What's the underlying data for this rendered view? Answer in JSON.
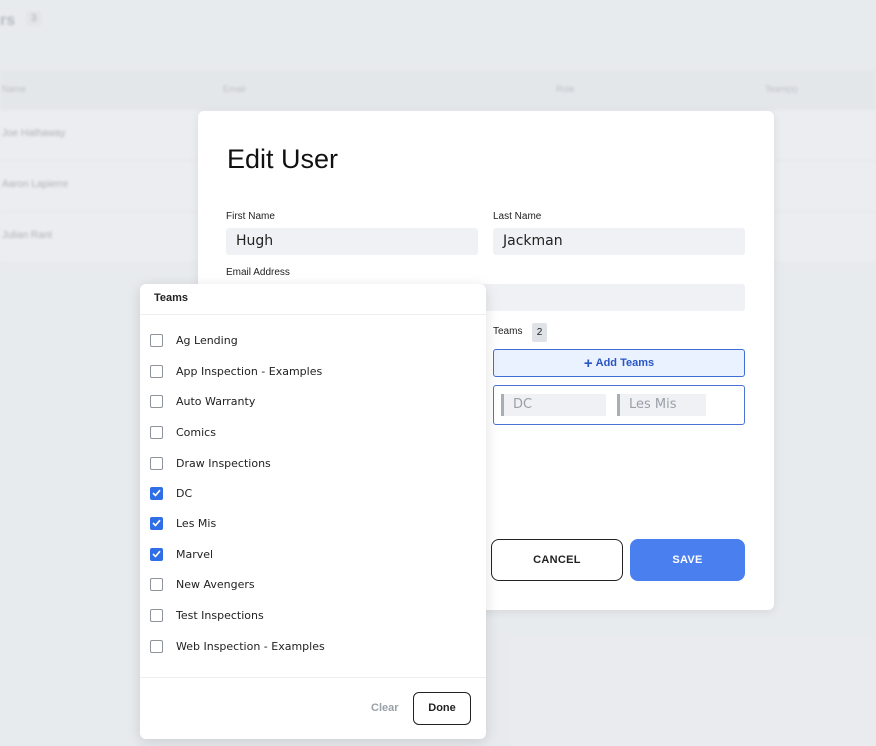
{
  "background": {
    "title_partial": "rs",
    "count": "3",
    "columns": [
      "Name",
      "Email",
      "Role",
      "Team(s)"
    ],
    "rows": [
      "Joe Hathaway",
      "Aaron Lapierre",
      "Julian Rant"
    ]
  },
  "modal": {
    "title": "Edit User",
    "first_name_label": "First Name",
    "first_name_value": "Hugh",
    "last_name_label": "Last Name",
    "last_name_value": "Jackman",
    "email_label": "Email Address",
    "email_value": "",
    "teams_label": "Teams",
    "teams_count": "2",
    "add_teams_label": "Add Teams",
    "chips": [
      "DC",
      "Les Mis"
    ],
    "cancel_label": "CANCEL",
    "save_label": "SAVE"
  },
  "teams_popover": {
    "title": "Teams",
    "options": [
      {
        "label": "Ag Lending",
        "checked": false
      },
      {
        "label": "App Inspection - Examples",
        "checked": false
      },
      {
        "label": "Auto Warranty",
        "checked": false
      },
      {
        "label": "Comics",
        "checked": false
      },
      {
        "label": "Draw Inspections",
        "checked": false
      },
      {
        "label": "DC",
        "checked": true
      },
      {
        "label": "Les Mis",
        "checked": true
      },
      {
        "label": "Marvel",
        "checked": true
      },
      {
        "label": "New Avengers",
        "checked": false
      },
      {
        "label": "Test Inspections",
        "checked": false
      },
      {
        "label": "Web Inspection - Examples",
        "checked": false
      }
    ],
    "clear_label": "Clear",
    "done_label": "Done"
  },
  "colors": {
    "accent": "#4a7ff0",
    "checkbox_checked": "#2f6ee6",
    "add_teams_bg": "#eaf1ff"
  }
}
